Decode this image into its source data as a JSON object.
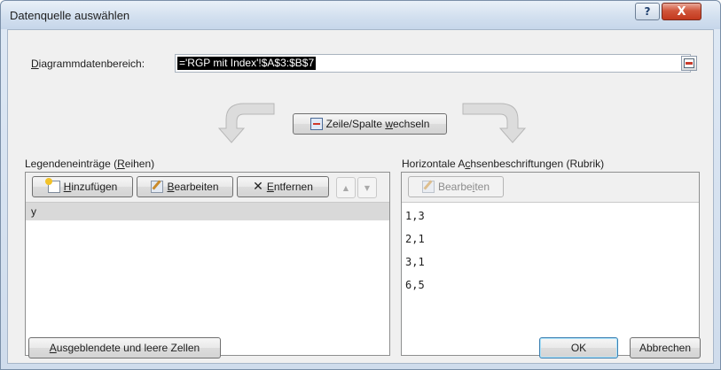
{
  "dialog": {
    "title": "Datenquelle auswählen",
    "help_glyph": "?",
    "close_glyph": "X"
  },
  "data_range": {
    "label_prefix": "",
    "label_accel": "D",
    "label_rest": "iagrammdatenbereich:",
    "value": "='RGP mit Index'!$A$3:$B$7"
  },
  "swap_button": {
    "label_a": "Zeile/Spalte ",
    "label_accel": "w",
    "label_b": "echseln"
  },
  "legend": {
    "heading_a": "Legendeneinträge (",
    "heading_accel": "R",
    "heading_b": "eihen)",
    "add_accel": "H",
    "add_rest": "inzufügen",
    "edit_accel": "B",
    "edit_rest": "earbeiten",
    "remove_accel": "E",
    "remove_rest": "ntfernen",
    "up_glyph": "▲",
    "down_glyph": "▼",
    "entries": [
      "y"
    ]
  },
  "categories": {
    "heading_a": "Horizontale A",
    "heading_accel": "c",
    "heading_b": "hsenbeschriftungen (Rubrik)",
    "edit_a": "Bearbe",
    "edit_accel": "i",
    "edit_b": "ten",
    "items": [
      "1,3",
      "2,1",
      "3,1",
      "6,5"
    ]
  },
  "footer": {
    "hidden_accel": "A",
    "hidden_rest": "usgeblendete und leere Zellen",
    "ok_label": "OK",
    "cancel_label": "Abbrechen"
  },
  "colors": {
    "selection_bg": "#000000",
    "selected_row": "#d9d9d9",
    "close_button": "#c3391e"
  }
}
